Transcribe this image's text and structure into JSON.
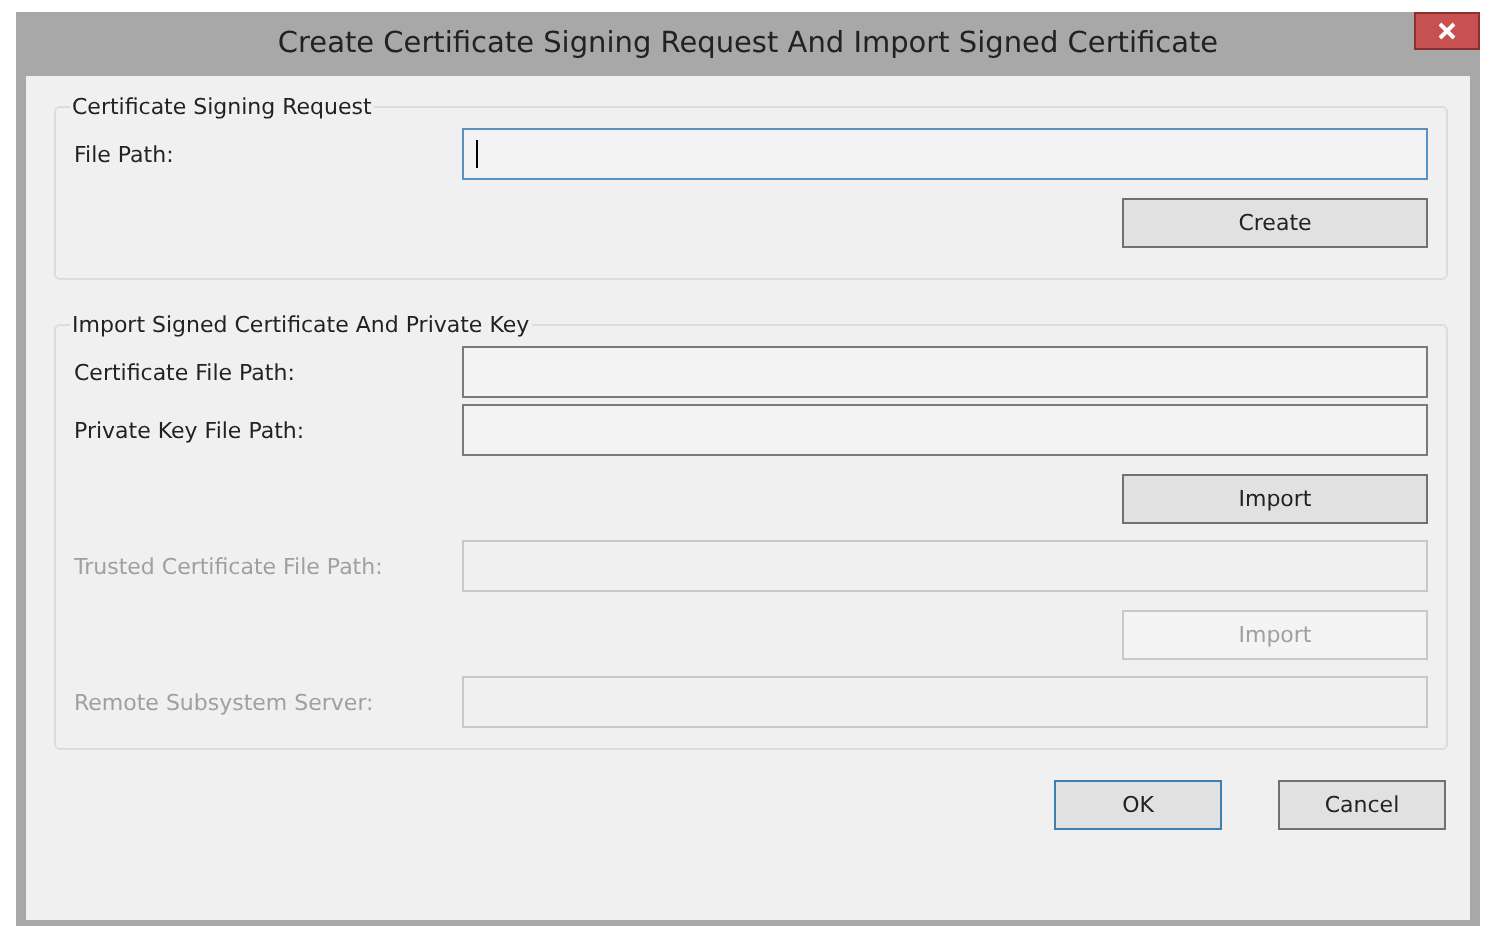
{
  "window": {
    "title": "Create Certificate Signing Request And Import Signed Certificate"
  },
  "sections": [
    {
      "title": "Certificate Signing Request",
      "rows": [
        {
          "kind": "field",
          "label": "File Path:",
          "disabled": false,
          "focused": true
        },
        {
          "kind": "button",
          "label": "Create",
          "disabled": false
        }
      ]
    },
    {
      "title": "Import Signed Certificate And Private Key",
      "rows": [
        {
          "kind": "field",
          "label": "Certificate File Path:",
          "disabled": false,
          "focused": false
        },
        {
          "kind": "field",
          "label": "Private Key File Path:",
          "disabled": false,
          "focused": false
        },
        {
          "kind": "button",
          "label": "Import",
          "disabled": false
        },
        {
          "kind": "field",
          "label": "Trusted Certificate File Path:",
          "disabled": true,
          "focused": false
        },
        {
          "kind": "button",
          "label": "Import",
          "disabled": true
        },
        {
          "kind": "field",
          "label": "Remote Subsystem Server:",
          "disabled": true,
          "focused": false
        }
      ]
    }
  ],
  "buttons": [
    {
      "label": "OK",
      "default": true
    },
    {
      "label": "Cancel",
      "default": false
    }
  ]
}
